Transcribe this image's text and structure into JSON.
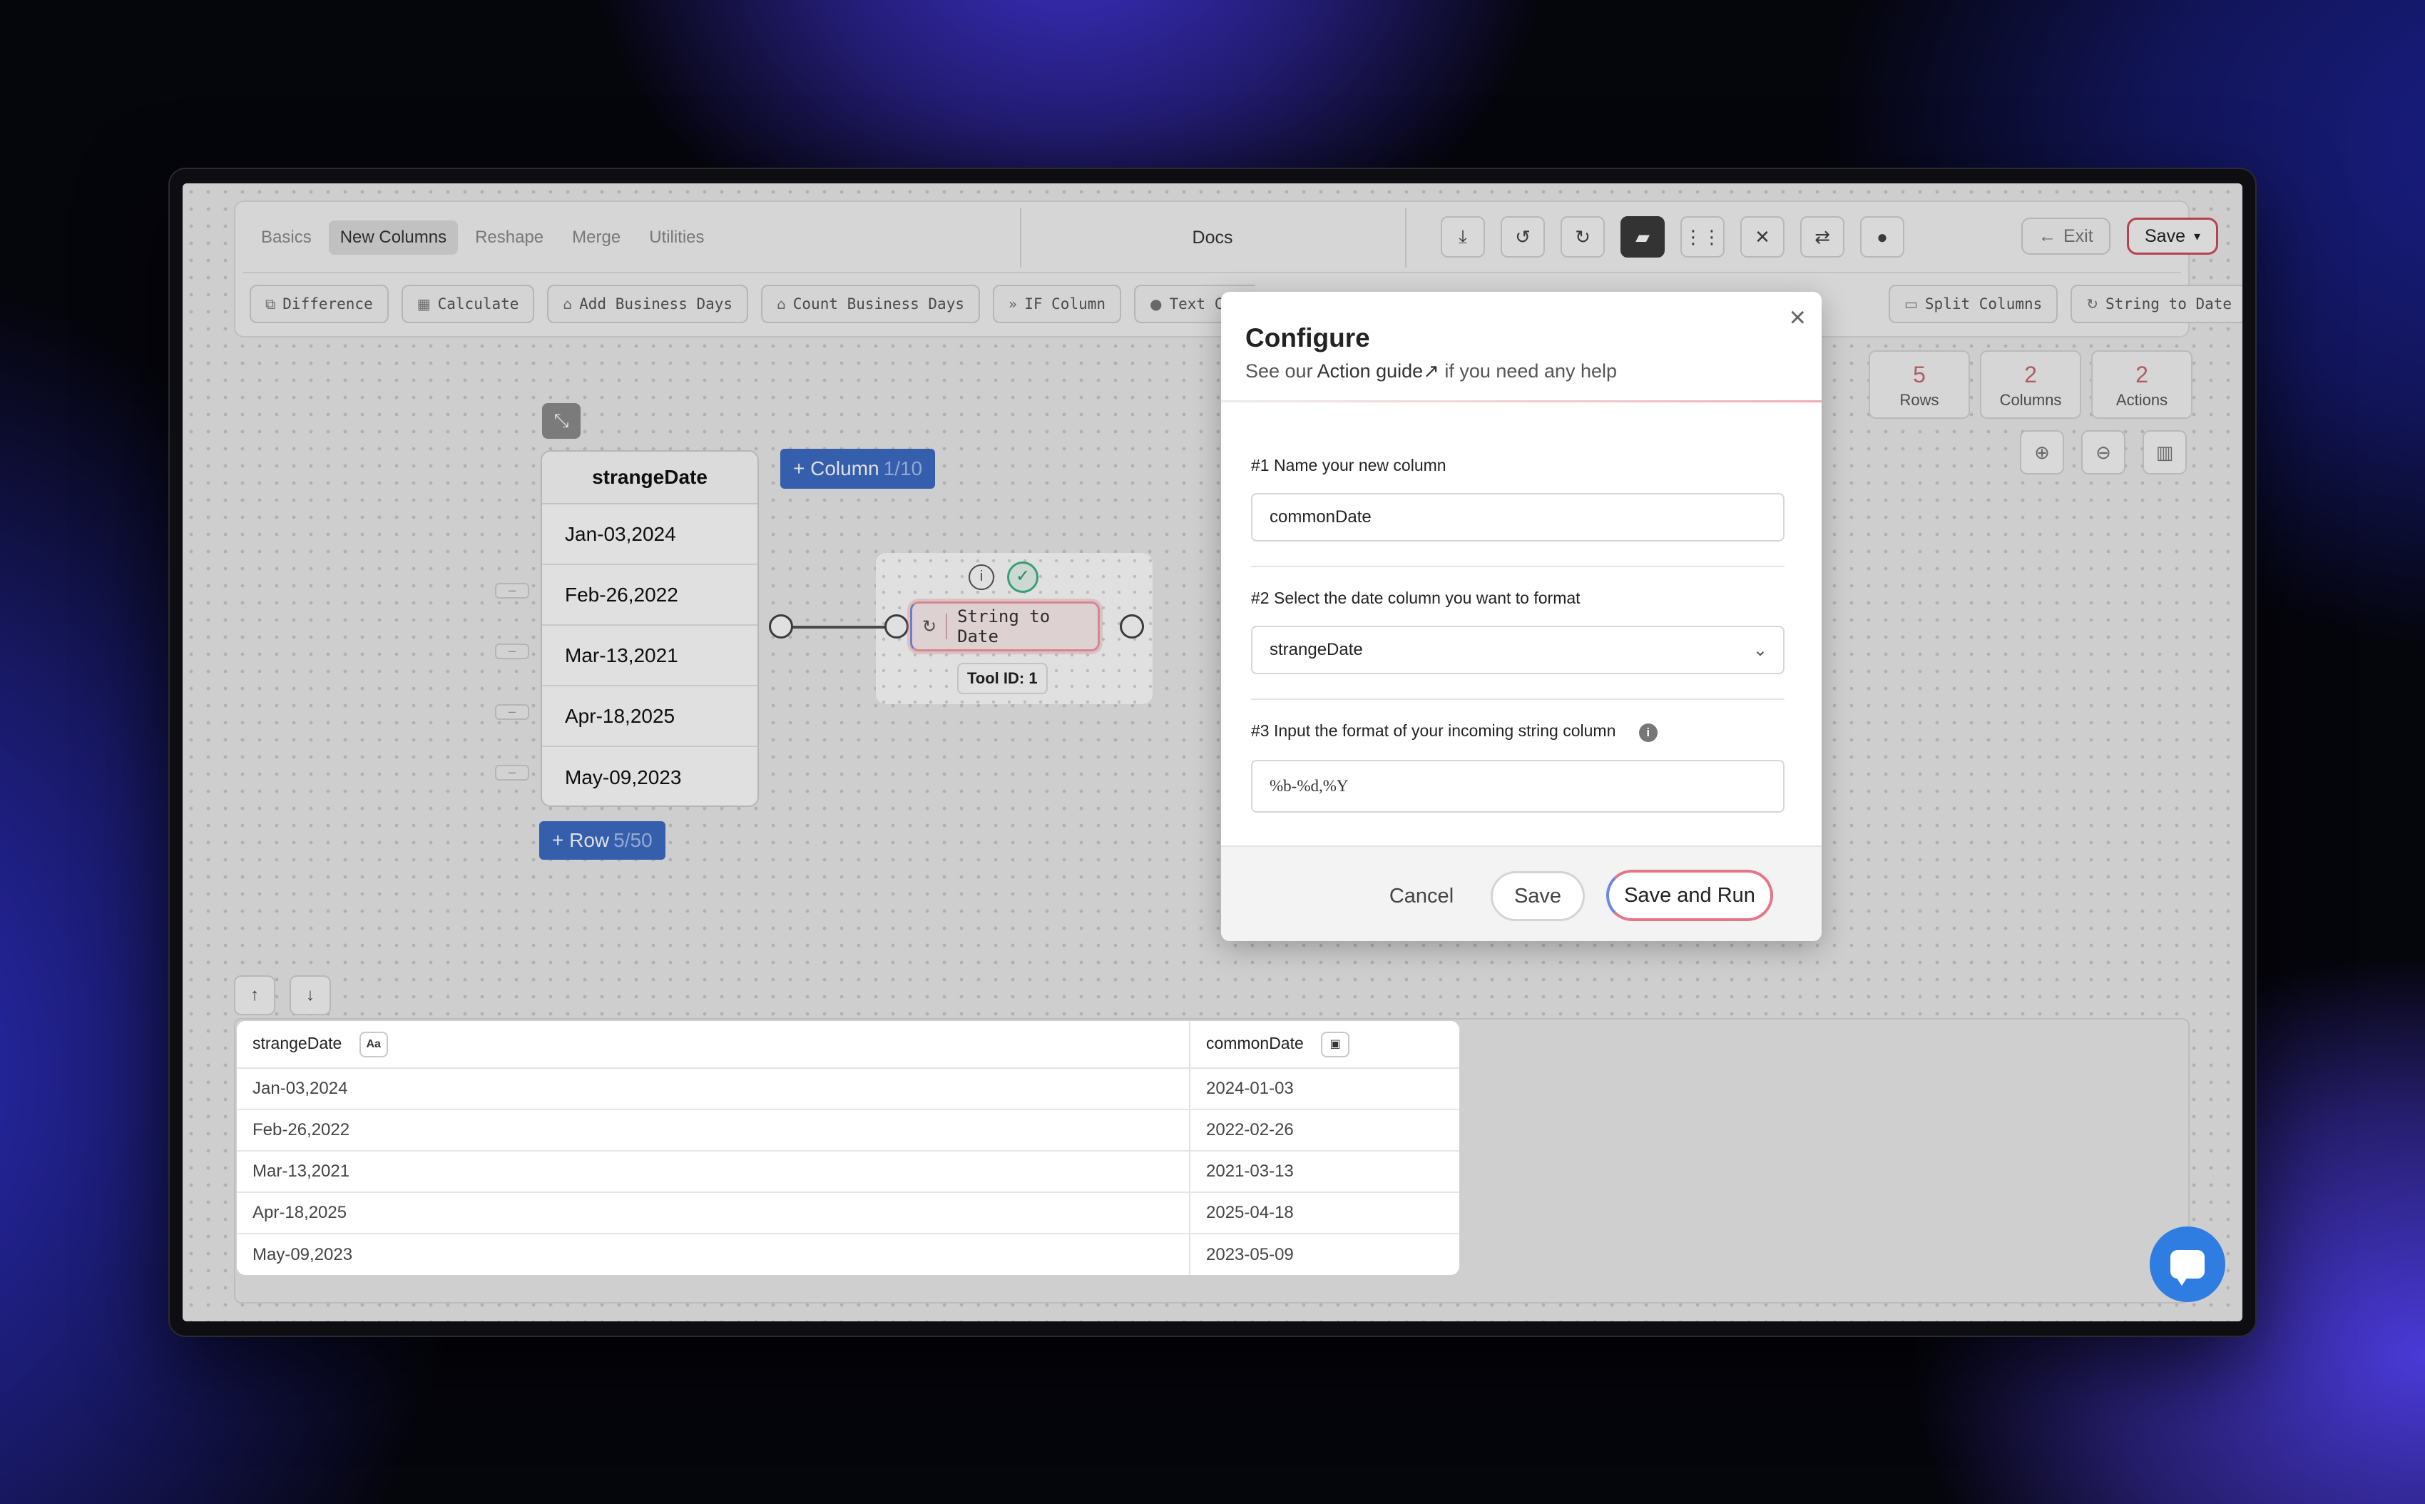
{
  "toolbar": {
    "tabs": [
      "Basics",
      "New Columns",
      "Reshape",
      "Merge",
      "Utilities"
    ],
    "active_tab": "New Columns",
    "docs_label": "Docs",
    "exit_label": "Exit",
    "save_label": "Save",
    "icons": [
      "download-icon",
      "undo-icon",
      "redo-icon",
      "note-icon",
      "grid-icon",
      "clear-icon",
      "swap-icon",
      "play-icon"
    ],
    "actions": [
      "Difference",
      "Calculate",
      "Add Business Days",
      "Count Business Days",
      "IF Column",
      "Text Colu"
    ],
    "actions_right": [
      "Split Columns",
      "String to Date"
    ]
  },
  "stats": [
    {
      "value": "5",
      "label": "Rows"
    },
    {
      "value": "2",
      "label": "Columns"
    },
    {
      "value": "2",
      "label": "Actions"
    }
  ],
  "source_table": {
    "header": "strangeDate",
    "rows": [
      "Jan-03,2024",
      "Feb-26,2022",
      "Mar-13,2021",
      "Apr-18,2025",
      "May-09,2023"
    ],
    "add_column": {
      "label": "+ Column",
      "count": "1/10"
    },
    "add_row": {
      "label": "+ Row",
      "count": "5/50"
    }
  },
  "tool_node": {
    "label": "String to Date",
    "tool_id": "Tool ID: 1"
  },
  "data_grid": {
    "columns": [
      {
        "name": "strangeDate",
        "type_badge": "Aa"
      },
      {
        "name": "commonDate",
        "type_badge": "calendar-icon"
      }
    ],
    "rows": [
      [
        "Jan-03,2024",
        "2024-01-03"
      ],
      [
        "Feb-26,2022",
        "2022-02-26"
      ],
      [
        "Mar-13,2021",
        "2021-03-13"
      ],
      [
        "Apr-18,2025",
        "2025-04-18"
      ],
      [
        "May-09,2023",
        "2023-05-09"
      ]
    ]
  },
  "modal": {
    "title": "Configure",
    "subtitle_prefix": "See our",
    "guide_link": "Action guide",
    "subtitle_suffix": "if you need any help",
    "step1_label": "#1 Name your new column",
    "step1_value": "commonDate",
    "step2_label": "#2 Select the date column you want to format",
    "step2_value": "strangeDate",
    "step3_label": "#3 Input the format of your incoming string column",
    "step3_value": "%b-%d,%Y",
    "cancel_label": "Cancel",
    "save_label": "Save",
    "run_label": "Save and Run"
  },
  "colors": {
    "accent_blue": "#3d6cc4",
    "accent_pink": "#e47688",
    "chat_blue": "#2f7de1"
  }
}
